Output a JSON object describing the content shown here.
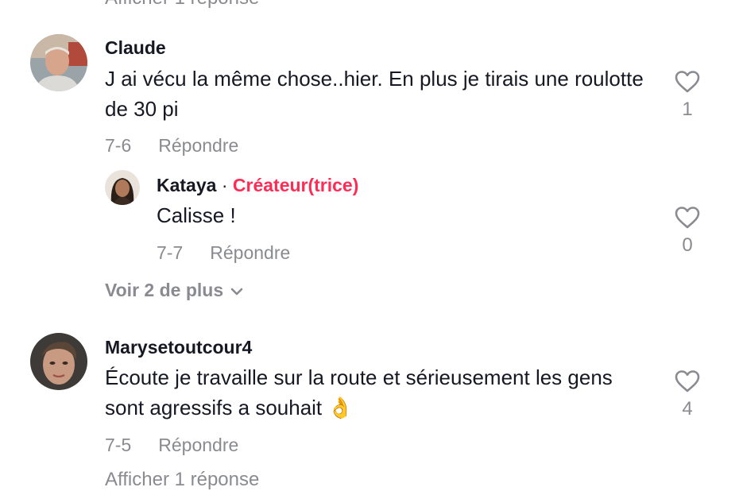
{
  "top_truncated_text": "Afficher 1 réponse",
  "bottom_truncated_text": "Afficher 1 réponse",
  "colors": {
    "creator": "#fe2c55",
    "muted": "#8a8b91",
    "text": "#161823"
  },
  "comments": [
    {
      "username": "Claude",
      "text": "J ai vécu la même chose..hier. En plus je tirais une roulotte de 30 pi",
      "date": "7-6",
      "reply_label": "Répondre",
      "like_count": "1",
      "like_icon": "heart-outline-icon"
    },
    {
      "username": "Kataya",
      "separator": "·",
      "creator_label": "Créateur(trice)",
      "text": "Calisse !",
      "date": "7-7",
      "reply_label": "Répondre",
      "like_count": "0",
      "like_icon": "heart-outline-icon"
    },
    {
      "username": "Marysetoutcour4",
      "text": "Écoute je travaille sur la route et sérieusement les gens sont agressifs a souhait 👌",
      "date": "7-5",
      "reply_label": "Répondre",
      "like_count": "4",
      "like_icon": "heart-outline-icon"
    }
  ],
  "view_more_label": "Voir 2 de plus"
}
